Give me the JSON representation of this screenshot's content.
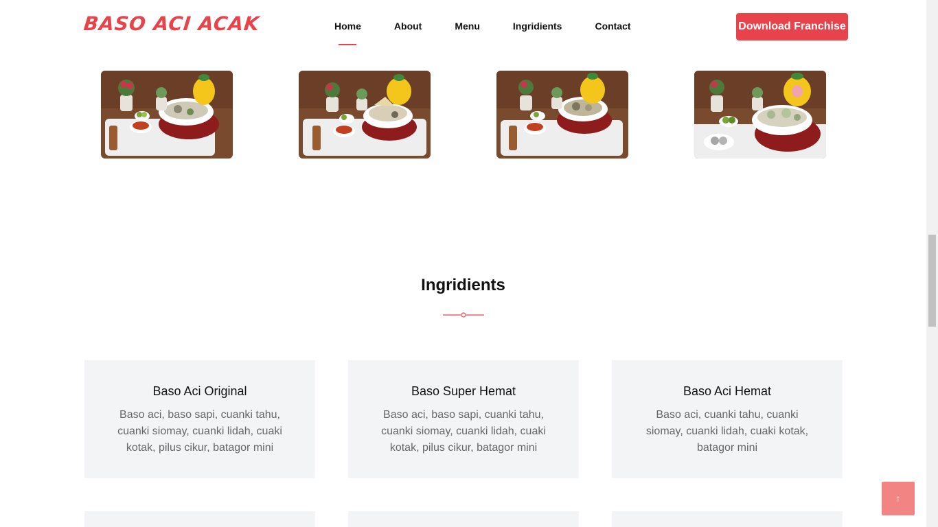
{
  "header": {
    "logo": "BASO ACI ACAK",
    "nav": [
      {
        "label": "Home",
        "active": true
      },
      {
        "label": "About"
      },
      {
        "label": "Menu"
      },
      {
        "label": "Ingridients"
      },
      {
        "label": "Contact"
      }
    ],
    "cta_label": "Download Franchise"
  },
  "gallery": {
    "images": [
      "baso-aci-dish-photo",
      "baso-aci-dish-photo",
      "baso-aci-dish-photo",
      "baso-aci-dish-photo"
    ]
  },
  "ingredients": {
    "title": "Ingridients",
    "cards": [
      {
        "title": "Baso Aci Original",
        "description": "Baso aci, baso sapi, cuanki tahu, cuanki siomay, cuanki lidah, cuaki kotak, pilus cikur, batagor mini"
      },
      {
        "title": "Baso Super Hemat",
        "description": "Baso aci, baso sapi, cuanki tahu, cuanki siomay, cuanki lidah, cuaki kotak, pilus cikur, batagor mini"
      },
      {
        "title": "Baso Aci Hemat",
        "description": "Baso aci, cuanki tahu, cuanki siomay, cuanki lidah, cuaki kotak, batagor mini"
      }
    ]
  },
  "back_to_top": {
    "icon": "arrow-up-icon",
    "glyph": "↑"
  },
  "colors": {
    "accent": "#e8434a",
    "card_bg": "#f3f4f6",
    "back_top_bg": "#f28583"
  }
}
